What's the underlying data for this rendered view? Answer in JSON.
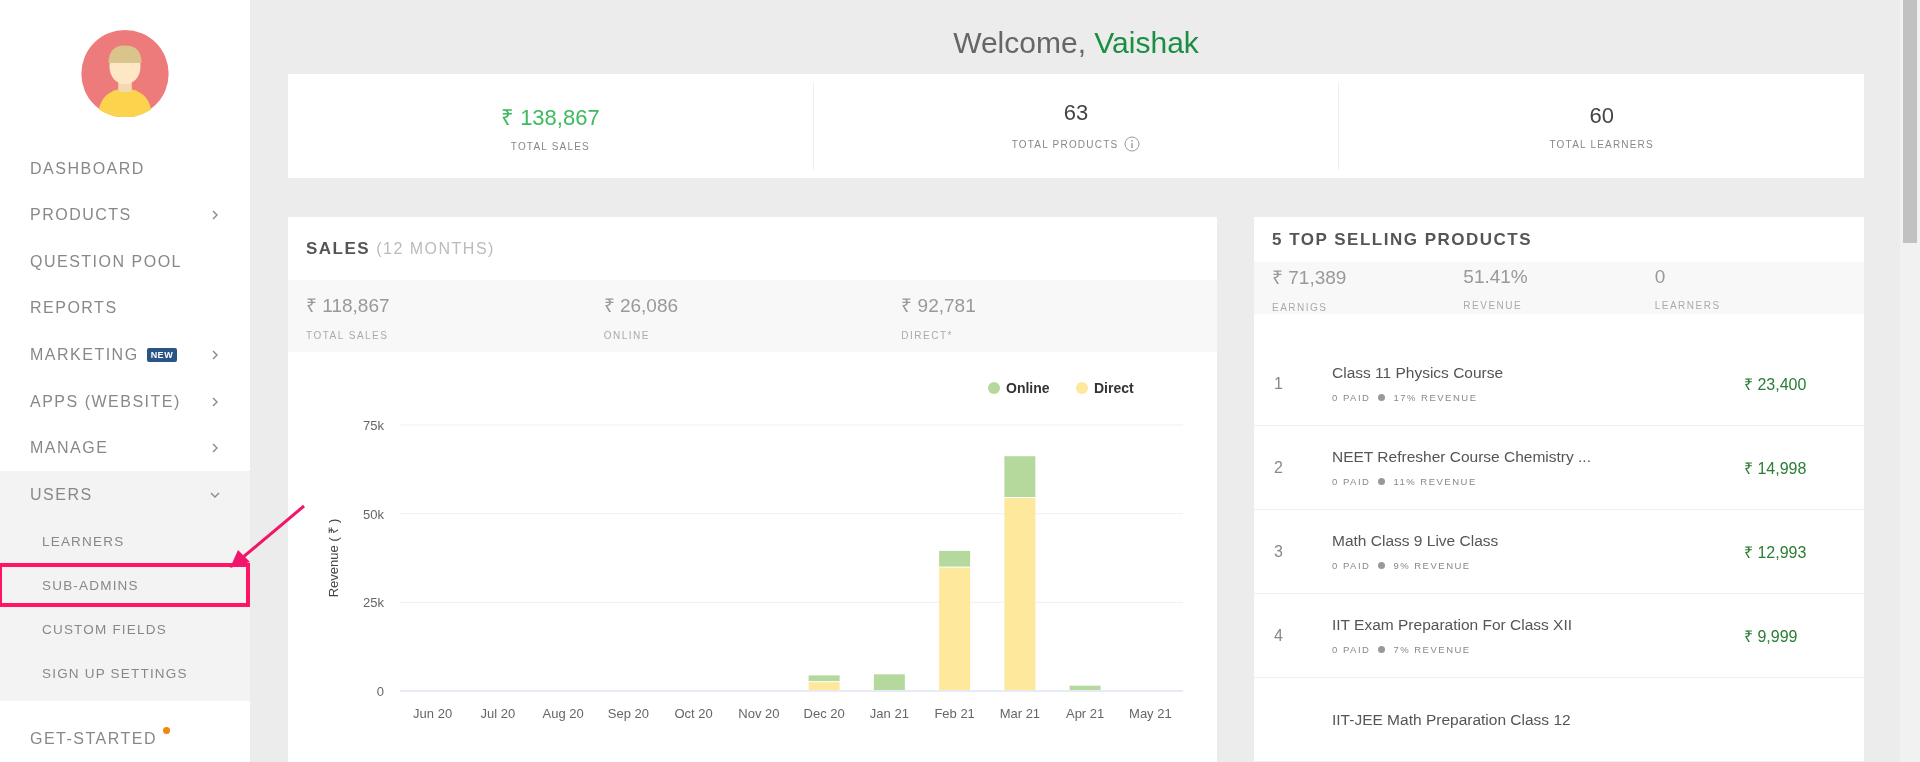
{
  "sidebar": {
    "items": [
      {
        "label": "DASHBOARD",
        "kind": "link"
      },
      {
        "label": "PRODUCTS",
        "kind": "menu",
        "expanded": false
      },
      {
        "label": "QUESTION POOL",
        "kind": "link"
      },
      {
        "label": "REPORTS",
        "kind": "link"
      },
      {
        "label": "MARKETING",
        "kind": "menu",
        "expanded": false,
        "badge": "NEW"
      },
      {
        "label": "APPS (WEBSITE)",
        "kind": "menu",
        "expanded": false
      },
      {
        "label": "MANAGE",
        "kind": "menu",
        "expanded": false
      },
      {
        "label": "USERS",
        "kind": "menu",
        "expanded": true,
        "children": [
          {
            "label": "LEARNERS",
            "highlighted": false
          },
          {
            "label": "SUB-ADMINS",
            "highlighted": true
          },
          {
            "label": "CUSTOM FIELDS",
            "highlighted": false
          },
          {
            "label": "SIGN UP SETTINGS",
            "highlighted": false
          }
        ]
      },
      {
        "label": "GET-STARTED",
        "kind": "link",
        "notification": true
      }
    ]
  },
  "welcome": {
    "greeting": "Welcome,",
    "user_name": "Vaishak"
  },
  "summary": [
    {
      "value": "₹ 138,867",
      "label": "TOTAL SALES",
      "kind": "currency",
      "info": false
    },
    {
      "value": "63",
      "label": "TOTAL PRODUCTS",
      "kind": "count",
      "info": true
    },
    {
      "value": "60",
      "label": "TOTAL LEARNERS",
      "kind": "count",
      "info": false
    }
  ],
  "sales": {
    "title": "SALES",
    "subtitle": "(12 MONTHS)",
    "stats": [
      {
        "value": "₹ 118,867",
        "label": "TOTAL SALES"
      },
      {
        "value": "₹ 26,086",
        "label": "ONLINE"
      },
      {
        "value": "₹ 92,781",
        "label": "DIRECT*"
      }
    ],
    "chart_data": {
      "type": "bar",
      "stacked": true,
      "legend": "top-right",
      "ylabel": "Revenue ( ₹ )",
      "categories": [
        "Jun 20",
        "Jul 20",
        "Aug 20",
        "Sep 20",
        "Oct 20",
        "Nov 20",
        "Dec 20",
        "Jan 21",
        "Feb 21",
        "Mar 21",
        "Apr 21",
        "May 21"
      ],
      "series": [
        {
          "name": "Online",
          "color": "#b5d99c",
          "values": [
            0,
            0,
            0,
            0,
            0,
            0,
            1900,
            4700,
            4700,
            11800,
            1500,
            0
          ]
        },
        {
          "name": "Direct",
          "color": "#fde89c",
          "values": [
            0,
            0,
            0,
            0,
            0,
            0,
            2500,
            0,
            34800,
            54400,
            0,
            0
          ]
        }
      ],
      "ylim": [
        0,
        75000
      ],
      "yticks": [
        {
          "value": 0,
          "label": "0"
        },
        {
          "value": 25000,
          "label": "25k"
        },
        {
          "value": 50000,
          "label": "50k"
        },
        {
          "value": 75000,
          "label": "75k"
        }
      ]
    }
  },
  "top_products": {
    "title": "5 TOP SELLING PRODUCTS",
    "stats": [
      {
        "value": "₹ 71,389",
        "label": "EARNIGS"
      },
      {
        "value": "51.41%",
        "label": "REVENUE"
      },
      {
        "value": "0",
        "label": "LEARNERS"
      }
    ],
    "rows": [
      {
        "rank": "1",
        "name": "Class 11 Physics Course",
        "paid": "0 PAID",
        "share": "17% REVENUE",
        "earnings": "₹ 23,400"
      },
      {
        "rank": "2",
        "name": "NEET Refresher Course Chemistry ...",
        "paid": "0 PAID",
        "share": "11% REVENUE",
        "earnings": "₹ 14,998"
      },
      {
        "rank": "3",
        "name": "Math Class 9 Live Class",
        "paid": "0 PAID",
        "share": "9% REVENUE",
        "earnings": "₹ 12,993"
      },
      {
        "rank": "4",
        "name": "IIT Exam Preparation For Class XII",
        "paid": "0 PAID",
        "share": "7% REVENUE",
        "earnings": "₹ 9,999"
      },
      {
        "name": "IIT-JEE Math Preparation Class 12"
      }
    ]
  }
}
